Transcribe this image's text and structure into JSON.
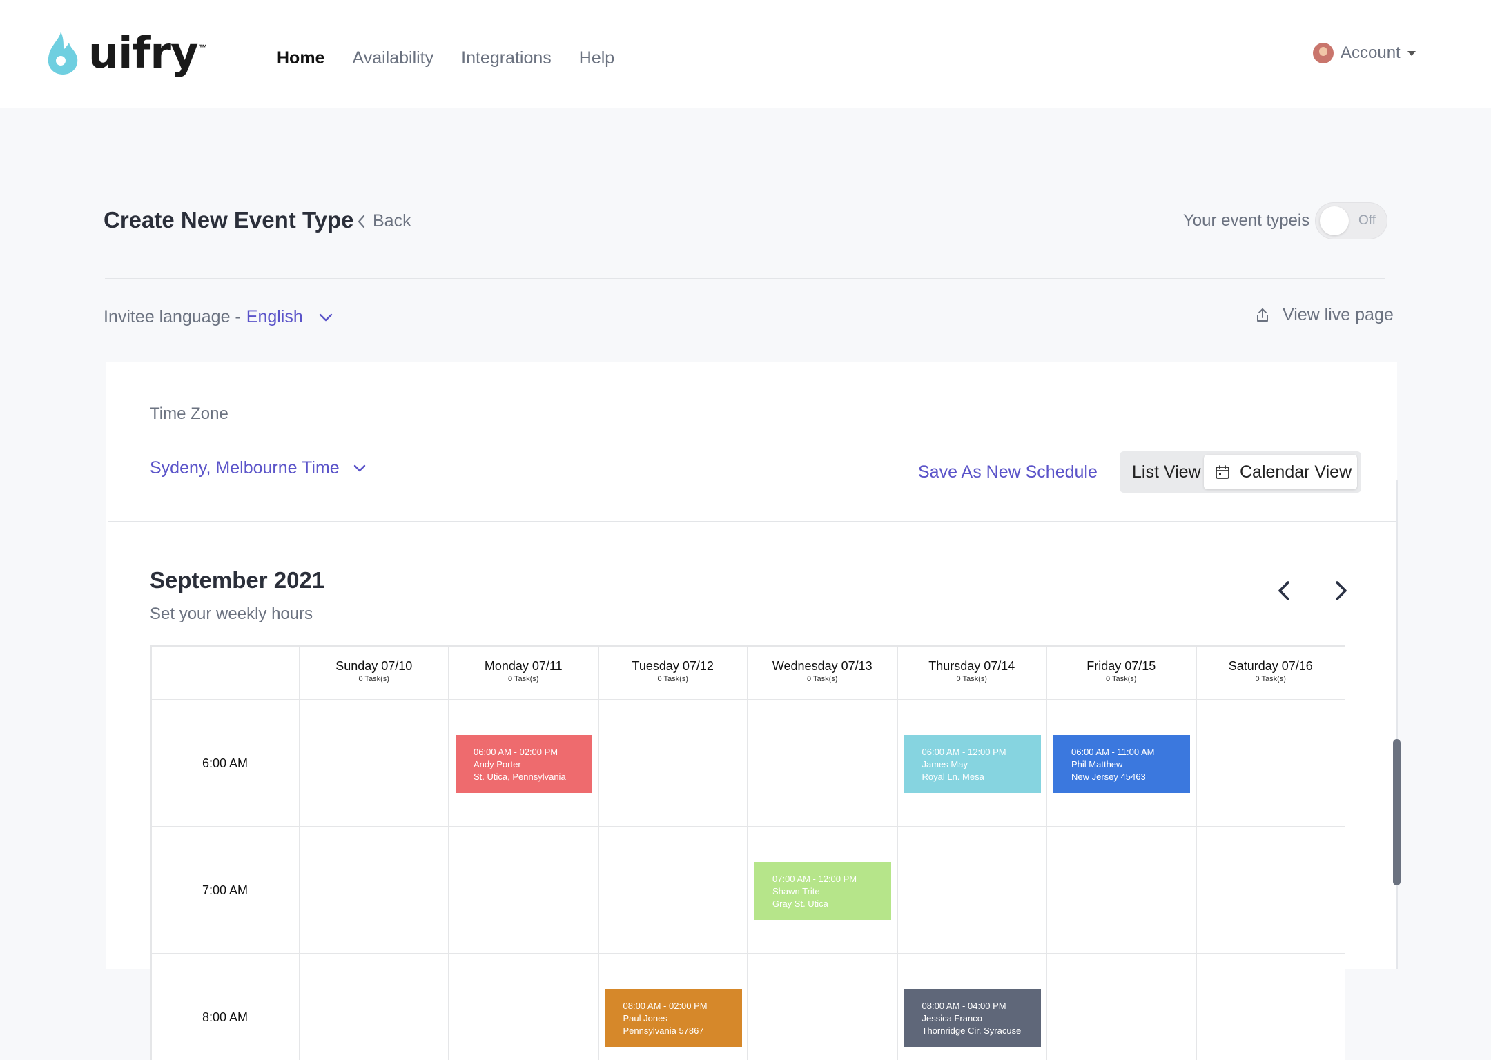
{
  "brand": {
    "name": "uifry",
    "tm": "™"
  },
  "nav": {
    "items": [
      "Home",
      "Availability",
      "Integrations",
      "Help"
    ],
    "active": "Home"
  },
  "account": {
    "label": "Account"
  },
  "header": {
    "title": "Create New Event Type",
    "back_label": "Back",
    "event_type_label": "Your event typeis",
    "toggle_state": "Off"
  },
  "language": {
    "label": "Invitee language - ",
    "value": "English"
  },
  "view_live": {
    "label": "View live page"
  },
  "timezone": {
    "label": "Time Zone",
    "value": "Sydeny, Melbourne Time"
  },
  "actions": {
    "save_schedule": "Save As New Schedule",
    "list_view": "List View",
    "calendar_view": "Calendar View"
  },
  "calendar": {
    "month": "September 2021",
    "subtitle": "Set your weekly hours",
    "days": [
      {
        "label": "Sunday 07/10",
        "tasks": "0 Task(s)"
      },
      {
        "label": "Monday 07/11",
        "tasks": "0 Task(s)"
      },
      {
        "label": "Tuesday 07/12",
        "tasks": "0 Task(s)"
      },
      {
        "label": "Wednesday 07/13",
        "tasks": "0 Task(s)"
      },
      {
        "label": "Thursday 07/14",
        "tasks": "0 Task(s)"
      },
      {
        "label": "Friday 07/15",
        "tasks": "0 Task(s)"
      },
      {
        "label": "Saturday 07/16",
        "tasks": "0 Task(s)"
      }
    ],
    "times": [
      "6:00 AM",
      "7:00 AM",
      "8:00 AM"
    ],
    "events": [
      {
        "day": 1,
        "row": 0,
        "time": "06:00 AM - 02:00 PM",
        "name": "Andy Porter",
        "place": "St. Utica, Pennsylvania",
        "color": "#ee6b6e"
      },
      {
        "day": 4,
        "row": 0,
        "time": "06:00 AM - 12:00 PM",
        "name": "James May",
        "place": "Royal Ln. Mesa",
        "color": "#86d4e0"
      },
      {
        "day": 5,
        "row": 0,
        "time": "06:00 AM - 11:00 AM",
        "name": "Phil Matthew",
        "place": "New Jersey 45463",
        "color": "#3b78de"
      },
      {
        "day": 3,
        "row": 1,
        "time": "07:00 AM - 12:00 PM",
        "name": "Shawn Trite",
        "place": "Gray St. Utica",
        "color": "#b6e58a"
      },
      {
        "day": 2,
        "row": 2,
        "time": "08:00 AM - 02:00 PM",
        "name": "Paul Jones",
        "place": "Pennsylvania 57867",
        "color": "#d6882a"
      },
      {
        "day": 4,
        "row": 2,
        "time": "08:00 AM - 04:00 PM",
        "name": "Jessica Franco",
        "place": "Thornridge Cir. Syracuse",
        "color": "#5f6779"
      }
    ]
  },
  "colors": {
    "accent": "#5b54c9",
    "logo": "#6fcfe0"
  },
  "icons": [
    "flame-logo-icon",
    "chevron-left-icon",
    "chevron-down-icon",
    "share-upload-icon",
    "calendar-icon",
    "chevron-right-icon"
  ]
}
